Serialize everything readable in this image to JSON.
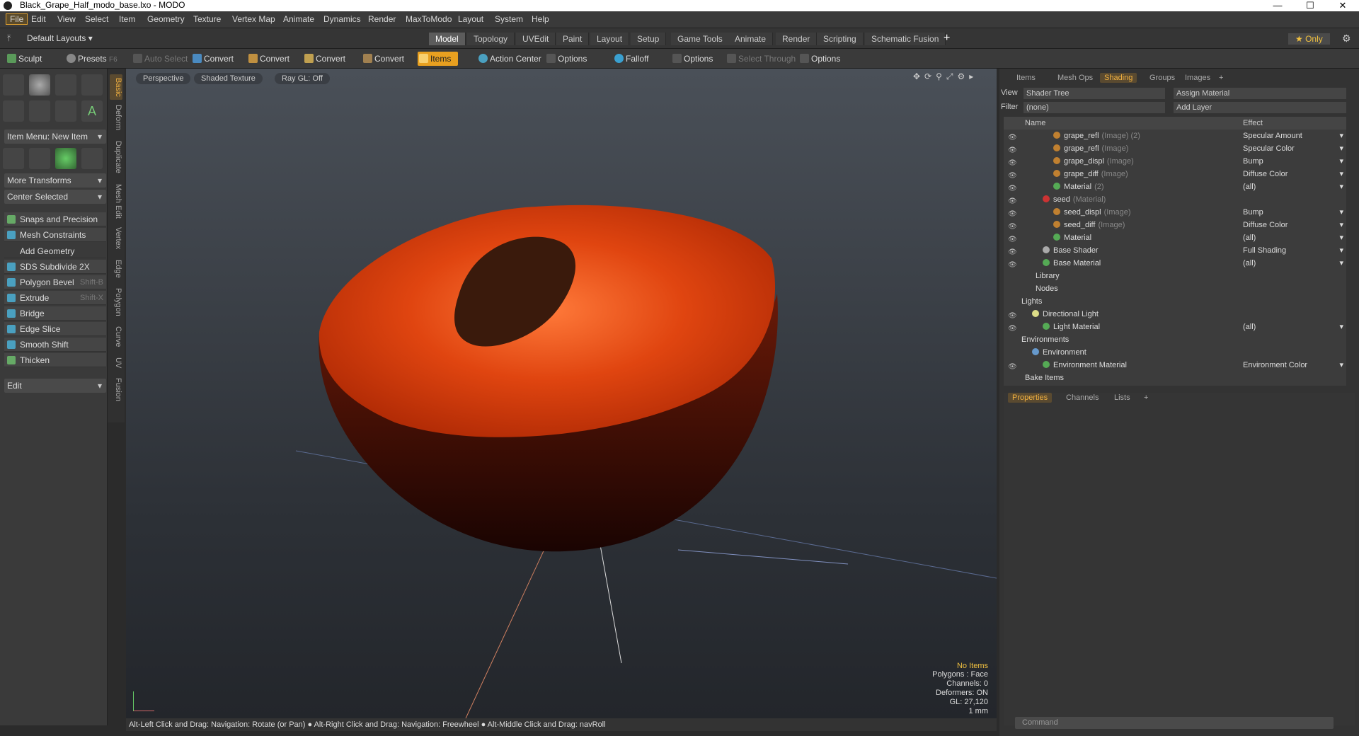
{
  "window": {
    "title": "Black_Grape_Half_modo_base.lxo - MODO",
    "minimize": "—",
    "maximize": "☐",
    "close": "✕"
  },
  "menu": [
    "File",
    "Edit",
    "View",
    "Select",
    "Item",
    "Geometry",
    "Texture",
    "Vertex Map",
    "Animate",
    "Dynamics",
    "Render",
    "MaxToModo",
    "Layout",
    "System",
    "Help"
  ],
  "layout": {
    "preset": "Default Layouts ▾",
    "tabs": [
      "Model",
      "Topology",
      "UVEdit",
      "Paint",
      "Layout",
      "Setup",
      "Game Tools",
      "Animate",
      "Render",
      "Scripting",
      "Schematic Fusion"
    ],
    "selected_tab": "Model",
    "add": "+",
    "only": "★ Only"
  },
  "toolbar": {
    "sculpt": "Sculpt",
    "presets": "Presets",
    "presets_key": "F6",
    "auto_select": "Auto Select",
    "convert": "Convert",
    "items": "Items",
    "action_center": "Action Center",
    "options": "Options",
    "falloff": "Falloff",
    "select_through": "Select Through"
  },
  "left": {
    "item_menu": "Item Menu: New Item",
    "more_transforms": "More Transforms",
    "center_selected": "Center Selected",
    "snaps": "Snaps and Precision",
    "constraints": "Mesh Constraints",
    "add_geometry": "Add Geometry",
    "tools": [
      {
        "label": "SDS Subdivide 2X",
        "shortcut": ""
      },
      {
        "label": "Polygon Bevel",
        "shortcut": "Shift-B"
      },
      {
        "label": "Extrude",
        "shortcut": "Shift-X"
      },
      {
        "label": "Bridge",
        "shortcut": ""
      },
      {
        "label": "Edge Slice",
        "shortcut": ""
      },
      {
        "label": "Smooth Shift",
        "shortcut": ""
      },
      {
        "label": "Thicken",
        "shortcut": ""
      }
    ],
    "edit": "Edit",
    "vtabs": [
      "Basic",
      "Deform",
      "Duplicate",
      "Mesh Edit",
      "Vertex",
      "Edge",
      "Polygon",
      "Curve",
      "UV",
      "Fusion"
    ]
  },
  "viewport": {
    "perspective": "Perspective",
    "shading": "Shaded Texture",
    "raygl": "Ray GL: Off",
    "info": {
      "no_items": "No Items",
      "polygons": "Polygons : Face",
      "channels": "Channels: 0",
      "deformers": "Deformers: ON",
      "gl": "GL: 27,120",
      "unit": "1 mm"
    }
  },
  "status": "Alt-Left Click and Drag: Navigation: Rotate (or Pan) ● Alt-Right Click and Drag: Navigation: Freewheel ● Alt-Middle Click and Drag: navRoll",
  "right": {
    "tabs": [
      "Items",
      "Mesh Ops",
      "Shading",
      "Groups",
      "Images",
      "+"
    ],
    "selected_tab": "Shading",
    "view_label": "View",
    "view_value": "Shader Tree",
    "assign": "Assign Material",
    "filter_label": "Filter",
    "filter_value": "(none)",
    "add_layer": "Add Layer",
    "col_name": "Name",
    "col_effect": "Effect",
    "rows": [
      {
        "name": "grape_refl",
        "sub": "(Image) (2)",
        "effect": "Specular Amount"
      },
      {
        "name": "grape_refl",
        "sub": "(Image)",
        "effect": "Specular Color"
      },
      {
        "name": "grape_displ",
        "sub": "(Image)",
        "effect": "Bump"
      },
      {
        "name": "grape_diff",
        "sub": "(Image)",
        "effect": "Diffuse Color"
      },
      {
        "name": "Material",
        "sub": "(2)",
        "effect": "(all)"
      },
      {
        "name": "seed",
        "sub": "(Material)",
        "effect": ""
      },
      {
        "name": "seed_displ",
        "sub": "(Image)",
        "effect": "Bump"
      },
      {
        "name": "seed_diff",
        "sub": "(Image)",
        "effect": "Diffuse Color"
      },
      {
        "name": "Material",
        "sub": "",
        "effect": "(all)"
      },
      {
        "name": "Base Shader",
        "sub": "",
        "effect": "Full Shading"
      },
      {
        "name": "Base Material",
        "sub": "",
        "effect": "(all)"
      },
      {
        "name": "Library",
        "sub": "",
        "effect": ""
      },
      {
        "name": "Nodes",
        "sub": "",
        "effect": ""
      },
      {
        "name": "Lights",
        "sub": "",
        "effect": ""
      },
      {
        "name": "Directional Light",
        "sub": "",
        "effect": ""
      },
      {
        "name": "Light Material",
        "sub": "",
        "effect": "(all)"
      },
      {
        "name": "Environments",
        "sub": "",
        "effect": ""
      },
      {
        "name": "Environment",
        "sub": "",
        "effect": ""
      },
      {
        "name": "Environment Material",
        "sub": "",
        "effect": "Environment Color"
      },
      {
        "name": "Bake Items",
        "sub": "",
        "effect": ""
      }
    ],
    "prop_tabs": [
      "Properties",
      "Channels",
      "Lists",
      "+"
    ],
    "command": "Command"
  }
}
